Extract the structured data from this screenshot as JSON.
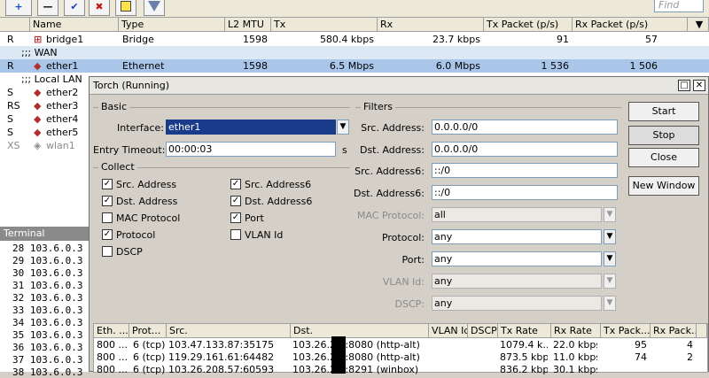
{
  "toolbar": {
    "add_label": "+",
    "minus_label": "—",
    "check_label": "✔",
    "x_label": "✖",
    "find_placeholder": "Find"
  },
  "iflist": {
    "headers": [
      "Name",
      "Type",
      "L2 MTU",
      "Tx",
      "Rx",
      "Tx Packet (p/s)",
      "Rx Packet (p/s)"
    ],
    "rows": [
      {
        "flag": "R",
        "name": "bridge1",
        "type": "Bridge",
        "mtu": "1598",
        "tx": "580.4 kbps",
        "rx": "23.7 kbps",
        "txp": "91",
        "rxp": "57"
      },
      {
        "group": ";;; WAN"
      },
      {
        "flag": "R",
        "name": "ether1",
        "type": "Ethernet",
        "mtu": "1598",
        "tx": "6.5 Mbps",
        "rx": "6.0 Mbps",
        "txp": "1 536",
        "rxp": "1 506"
      },
      {
        "group": ";;; Local LAN"
      },
      {
        "flag": "S",
        "name": "ether2"
      },
      {
        "flag": "RS",
        "name": "ether3"
      },
      {
        "flag": "S",
        "name": "ether4"
      },
      {
        "flag": "S",
        "name": "ether5"
      },
      {
        "flag": "XS",
        "name": "wlan1"
      }
    ]
  },
  "torch": {
    "title": "Torch (Running)",
    "basic_label": "Basic",
    "interface_label": "Interface:",
    "interface_value": "ether1",
    "timeout_label": "Entry Timeout:",
    "timeout_value": "00:00:03",
    "timeout_unit": "s",
    "collect_label": "Collect",
    "collect": [
      {
        "label": "Src. Address",
        "checked": true
      },
      {
        "label": "Dst. Address",
        "checked": true
      },
      {
        "label": "MAC Protocol",
        "checked": false
      },
      {
        "label": "Protocol",
        "checked": true
      },
      {
        "label": "DSCP",
        "checked": false
      },
      {
        "label": "Src. Address6",
        "checked": true
      },
      {
        "label": "Dst. Address6",
        "checked": true
      },
      {
        "label": "Port",
        "checked": true
      },
      {
        "label": "VLAN Id",
        "checked": false
      }
    ],
    "filters_label": "Filters",
    "filters": [
      {
        "label": "Src. Address:",
        "value": "0.0.0.0/0"
      },
      {
        "label": "Dst. Address:",
        "value": "0.0.0.0/0"
      },
      {
        "label": "Src. Address6:",
        "value": "::/0"
      },
      {
        "label": "Dst. Address6:",
        "value": "::/0"
      },
      {
        "label": "MAC Protocol:",
        "value": "all"
      },
      {
        "label": "Protocol:",
        "value": "any"
      },
      {
        "label": "Port:",
        "value": "any"
      },
      {
        "label": "VLAN Id:",
        "value": "any"
      },
      {
        "label": "DSCP:",
        "value": "any"
      }
    ],
    "buttons": {
      "start": "Start",
      "stop": "Stop",
      "close": "Close",
      "new_window": "New Window"
    },
    "table": {
      "headers": [
        "Eth. ...",
        "Prot...",
        "Src.",
        "Dst.",
        "VLAN Id",
        "DSCP",
        "Tx Rate",
        "Rx Rate",
        "Tx Pack...",
        "Rx Pack..."
      ],
      "rows": [
        {
          "eth": "800 ...",
          "prot": "6 (tcp)",
          "src": "103.47.133.87:35175",
          "dst": "103.26.2  .  :8080 (http-alt)",
          "tx": "1079.4 k...",
          "rx": "22.0 kbps",
          "txp": "95",
          "rxp": "4"
        },
        {
          "eth": "800 ...",
          "prot": "6 (tcp)",
          "src": "119.29.161.61:64482",
          "dst": "103.26.2  .  :8080 (http-alt)",
          "tx": "873.5 kbps",
          "rx": "11.0 kbps",
          "txp": "74",
          "rxp": "2"
        },
        {
          "eth": "800 ...",
          "prot": "6 (tcp)",
          "src": "103.26.208.57:60593",
          "dst": "103.26.2  .  :8291 (winbox)",
          "tx": "836.2 kbps",
          "rx": "30.1 kbps",
          "txp": "",
          "rxp": ""
        }
      ]
    }
  },
  "terminal": {
    "title": "Terminal",
    "lines": [
      "28 103.6.0.3",
      "29 103.6.0.3",
      "30 103.6.0.3",
      "31 103.6.0.3",
      "32 103.6.0.3",
      "33 103.6.0.3",
      "34 103.6.0.3",
      "35 103.6.0.3",
      "36 103.6.0.3",
      "37 103.6.0.3",
      "38 103.6.0.3"
    ]
  }
}
